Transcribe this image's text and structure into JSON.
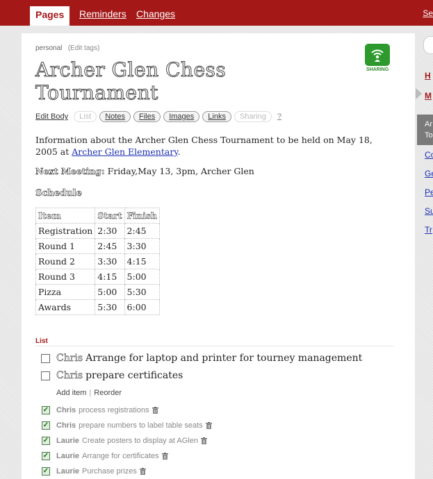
{
  "nav": {
    "tabs": [
      {
        "label": "Pages"
      },
      {
        "label": "Reminders"
      },
      {
        "label": "Changes"
      }
    ],
    "cut_link": "Se"
  },
  "page": {
    "tag": "personal",
    "edit_tags": "(Edit tags)",
    "title_line1": "Archer Glen Chess",
    "title_line2": "Tournament",
    "sharing_label": "SHARING"
  },
  "toolbar": {
    "edit_body": "Edit Body",
    "items": [
      {
        "label": "List"
      },
      {
        "label": "Notes"
      },
      {
        "label": "Files"
      },
      {
        "label": "Images"
      },
      {
        "label": "Links"
      },
      {
        "label": "Sharing"
      }
    ],
    "help": "?"
  },
  "body": {
    "intro_text": "Information about the Archer Glen Chess Tournament to be held on May 18, 2005 at ",
    "intro_link": "Archer Glen Elementary",
    "intro_end": ".",
    "meeting_label": "Next Meeting:",
    "meeting_text": " Friday,May 13, 3pm, Archer Glen",
    "schedule_heading": "Schedule"
  },
  "schedule": {
    "headers": [
      "Item",
      "Start",
      "Finish"
    ],
    "rows": [
      [
        "Registration",
        "2:30",
        "2:45"
      ],
      [
        "Round 1",
        "2:45",
        "3:30"
      ],
      [
        "Round 2",
        "3:30",
        "4:15"
      ],
      [
        "Round 3",
        "4:15",
        "5:00"
      ],
      [
        "Pizza",
        "5:00",
        "5:30"
      ],
      [
        "Awards",
        "5:30",
        "6:00"
      ]
    ]
  },
  "list": {
    "heading": "List",
    "open_items": [
      {
        "who": "Chris",
        "text": "Arrange for laptop and printer for tourney management"
      },
      {
        "who": "Chris",
        "text": "prepare certificates"
      }
    ],
    "add_item": "Add item",
    "reorder": "Reorder",
    "done_items": [
      {
        "who": "Chris",
        "text": "process registrations"
      },
      {
        "who": "Chris",
        "text": "prepare numbers to label table seats"
      },
      {
        "who": "Laurie",
        "text": "Create posters to display at AGlen"
      },
      {
        "who": "Laurie",
        "text": "Arrange for certificates"
      },
      {
        "who": "Laurie",
        "text": "Purchase prizes"
      }
    ]
  },
  "sidebar": {
    "links_red": [
      "H",
      "M"
    ],
    "block_text_1": "Ar",
    "block_text_2": "To",
    "links_blue": [
      "Co",
      "Ge",
      "Pe",
      "Su",
      "Tr"
    ]
  },
  "colors": {
    "brand": "#a41818",
    "link": "#1a2fb0",
    "sharing": "#2e9a2e"
  },
  "icons": [
    "sharing-icon",
    "trash-icon",
    "checkbox-icon"
  ]
}
